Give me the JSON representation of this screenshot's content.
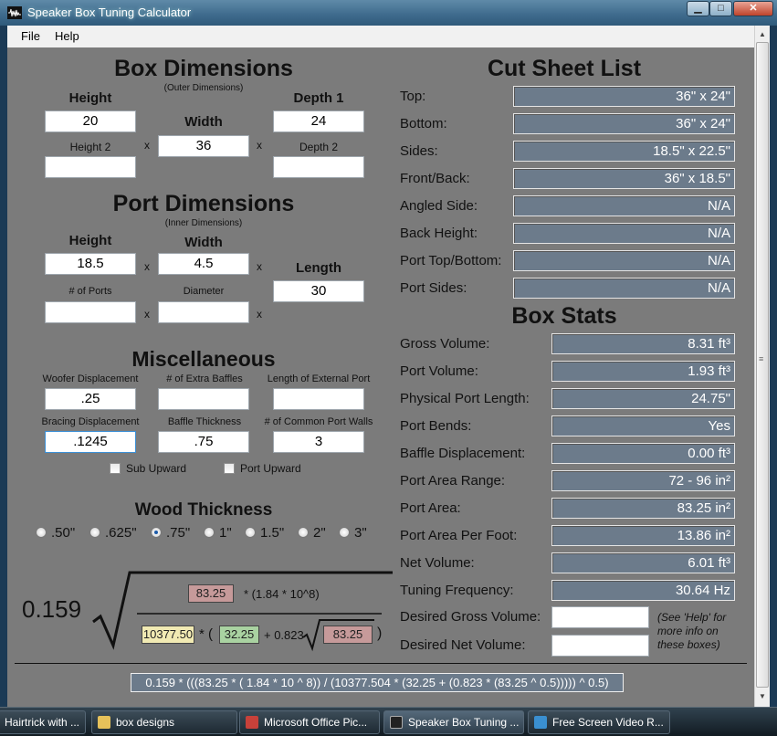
{
  "window": {
    "title": "Speaker Box Tuning Calculator",
    "controls": {
      "minimize": "▁",
      "maximize": "□",
      "close": "✕"
    }
  },
  "menu": {
    "file": "File",
    "help": "Help"
  },
  "box_dimensions": {
    "heading": "Box Dimensions",
    "subheading": "(Outer Dimensions)",
    "height_label": "Height",
    "height_value": "20",
    "width_label": "Width",
    "width_value": "36",
    "depth1_label": "Depth 1",
    "depth1_value": "24",
    "height2_label": "Height 2",
    "height2_value": "",
    "depth2_label": "Depth 2",
    "depth2_value": "",
    "times": "x"
  },
  "port_dimensions": {
    "heading": "Port Dimensions",
    "subheading": "(Inner Dimensions)",
    "height_label": "Height",
    "height_value": "18.5",
    "width_label": "Width",
    "width_value": "4.5",
    "length_label": "Length",
    "length_value": "30",
    "ports_label": "# of Ports",
    "ports_value": "",
    "diameter_label": "Diameter",
    "diameter_value": "",
    "times": "x"
  },
  "misc": {
    "heading": "Miscellaneous",
    "woofer_label": "Woofer Displacement",
    "woofer_value": ".25",
    "extra_baffles_label": "# of Extra Baffles",
    "extra_baffles_value": "",
    "ext_port_label": "Length of External Port",
    "ext_port_value": "",
    "bracing_label": "Bracing Displacement",
    "bracing_value": ".1245",
    "baffle_thickness_label": "Baffle Thickness",
    "baffle_thickness_value": ".75",
    "common_walls_label": "# of Common Port Walls",
    "common_walls_value": "3",
    "sub_upward": "Sub Upward",
    "port_upward": "Port Upward"
  },
  "wood": {
    "heading": "Wood Thickness",
    "options": [
      ".50\"",
      ".625\"",
      ".75\"",
      "1\"",
      "1.5\"",
      "2\"",
      "3\""
    ],
    "selected": ".75\""
  },
  "formula_panel": {
    "constant": "0.159",
    "area_top": "83.25",
    "top_text": "* (1.84 * 10^8)",
    "length_chip": "10377.50",
    "mult_open": "* (",
    "port_length_chip": "32.25",
    "plus_text": "+ 0.823",
    "area_inner": "83.25",
    "close_paren": ")",
    "expression": "0.159 * (((83.25 * ( 1.84 * 10 ^ 8)) / (10377.504 * (32.25 + (0.823 * (83.25 ^ 0.5))))) ^ 0.5)"
  },
  "cut_sheet": {
    "heading": "Cut Sheet List",
    "rows": [
      {
        "label": "Top:",
        "value": "36\" x 24\""
      },
      {
        "label": "Bottom:",
        "value": "36\" x 24\""
      },
      {
        "label": "Sides:",
        "value": "18.5\" x 22.5\""
      },
      {
        "label": "Front/Back:",
        "value": "36\" x 18.5\""
      },
      {
        "label": "Angled Side:",
        "value": "N/A"
      },
      {
        "label": "Back Height:",
        "value": "N/A"
      },
      {
        "label": "Port Top/Bottom:",
        "value": "N/A"
      },
      {
        "label": "Port Sides:",
        "value": "N/A"
      }
    ]
  },
  "box_stats": {
    "heading": "Box Stats",
    "rows": [
      {
        "label": "Gross Volume:",
        "value": "8.31 ft³"
      },
      {
        "label": "Port Volume:",
        "value": "1.93 ft³"
      },
      {
        "label": "Physical Port Length:",
        "value": "24.75\""
      },
      {
        "label": "Port Bends:",
        "value": "Yes"
      },
      {
        "label": "Baffle Displacement:",
        "value": "0.00 ft³"
      },
      {
        "label": "Port Area Range:",
        "value": "72 - 96 in²"
      },
      {
        "label": "Port Area:",
        "value": "83.25 in²"
      },
      {
        "label": "Port Area Per Foot:",
        "value": "13.86 in²"
      },
      {
        "label": "Net Volume:",
        "value": "6.01 ft³"
      },
      {
        "label": "Tuning Frequency:",
        "value": "30.64 Hz"
      }
    ],
    "desired_gross_label": "Desired Gross Volume:",
    "desired_gross_value": "",
    "desired_net_label": "Desired Net Volume:",
    "desired_net_value": "",
    "help_note": "(See 'Help' for more info on these boxes)"
  },
  "taskbar": {
    "items": [
      {
        "label": "Hairtrick with ...",
        "color": "#d9d9d9"
      },
      {
        "label": "box designs",
        "color": "#e6c15a"
      },
      {
        "label": "Microsoft Office Pic...",
        "color": "#c8413a"
      },
      {
        "label": "Speaker Box Tuning ...",
        "color": "#222222"
      },
      {
        "label": "Free Screen Video R...",
        "color": "#3a8fd0"
      }
    ]
  }
}
